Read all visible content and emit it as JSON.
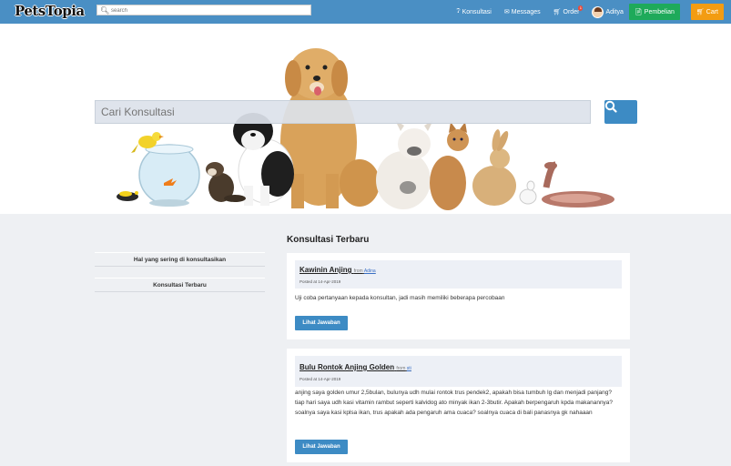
{
  "navbar": {
    "logo": "PetsTopia",
    "search_placeholder": "search",
    "links": [
      {
        "label": "Konsultasi",
        "icon": "question-circle-icon"
      },
      {
        "label": "Messages",
        "icon": "envelope-icon"
      },
      {
        "label": "Order",
        "icon": "cart-icon",
        "badge": "1"
      }
    ],
    "user_name": "Aditya",
    "pembelian_label": "Pembelian",
    "cart_label": "Cart",
    "colors": {
      "bar": "#4a8fc4",
      "pembelian": "#1eaa5a",
      "cart": "#f39c12"
    }
  },
  "hero": {
    "search_placeholder": "Cari Konsultasi",
    "search_icon": "search-icon"
  },
  "sidebar": {
    "items": [
      {
        "label": "Hal yang sering di konsultasikan"
      },
      {
        "label": "Konsultasi Terbaru"
      }
    ]
  },
  "main": {
    "section_title": "Konsultasi Terbaru",
    "posts": [
      {
        "title": "Kawinin Anjing",
        "from_label": "from",
        "author": "Adina",
        "posted": "Posted at 14-Apr-2019",
        "body": "Uji coba pertanyaan kepada konsultan, jadi masih memiliki beberapa percobaan",
        "button": "Lihat Jawaban"
      },
      {
        "title": "Bulu Rontok Anjing Golden",
        "from_label": "from",
        "author": "sti",
        "posted": "Posted at 14-Apr-2019",
        "body": "anjing saya golden umur 2,5bulan, bulunya udh mulai rontok trus pendek2, apakah bisa tumbuh lg dan menjadi panjang? tiap hari saya udh kasi vitamin rambut seperti kalvidog ato minyak ikan 2-3butir. Apakah berpengaruh kpda makanannya? soalnya saya kasi kplsa ikan, trus apakah ada pengaruh ama cuaca? soalnya cuaca di bali panasnya gk nahaaan",
        "button": "Lihat Jawaban"
      }
    ]
  }
}
